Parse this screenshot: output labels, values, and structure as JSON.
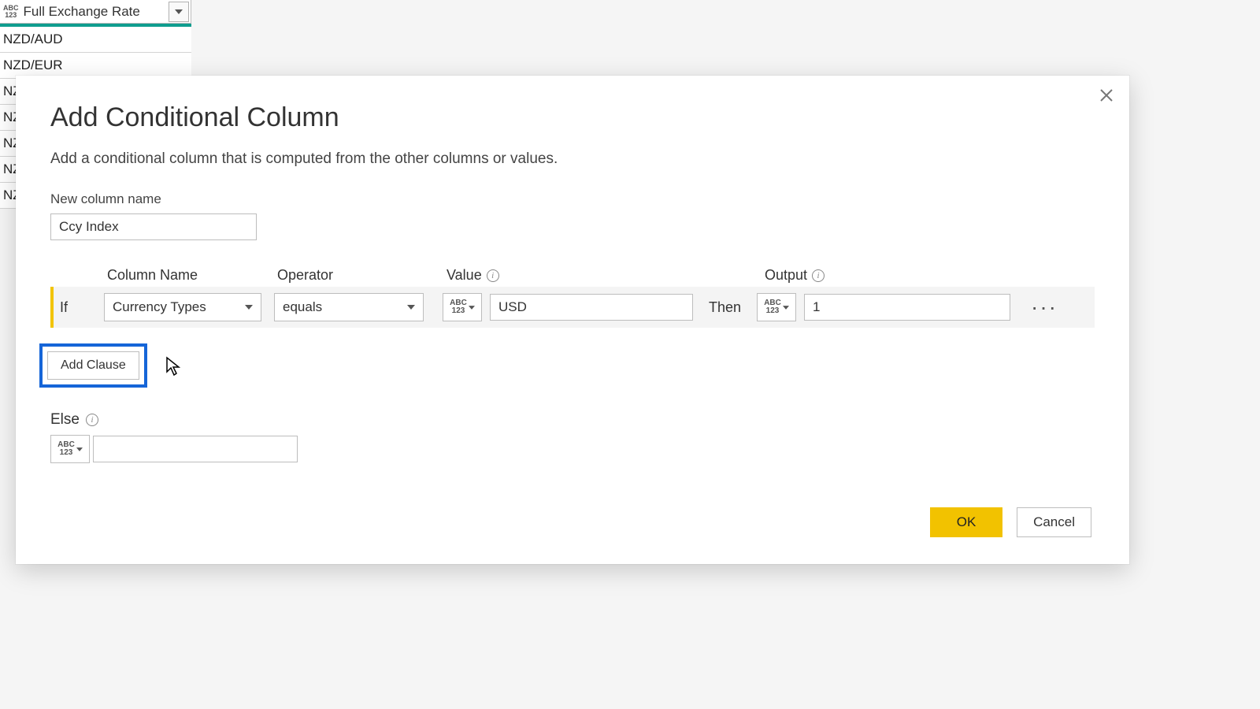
{
  "background": {
    "column_type": "ABC 123",
    "column_title": "Full Exchange Rate",
    "rows": [
      "NZD/AUD",
      "NZD/EUR",
      "NZ",
      "NZ",
      "NZ",
      "NZ",
      "NZ"
    ]
  },
  "dialog": {
    "title": "Add Conditional Column",
    "subtitle": "Add a conditional column that is computed from the other columns or values.",
    "new_column_label": "New column name",
    "new_column_value": "Ccy Index",
    "headers": {
      "column": "Column Name",
      "operator": "Operator",
      "value": "Value",
      "output": "Output"
    },
    "clause": {
      "if": "If",
      "column": "Currency Types",
      "operator": "equals",
      "value_type": "ABC 123",
      "value": "USD",
      "then": "Then",
      "output_type": "ABC 123",
      "output": "1"
    },
    "add_clause": "Add Clause",
    "else_label": "Else",
    "else_type": "ABC 123",
    "else_value": "",
    "ok": "OK",
    "cancel": "Cancel",
    "info_char": "i"
  }
}
